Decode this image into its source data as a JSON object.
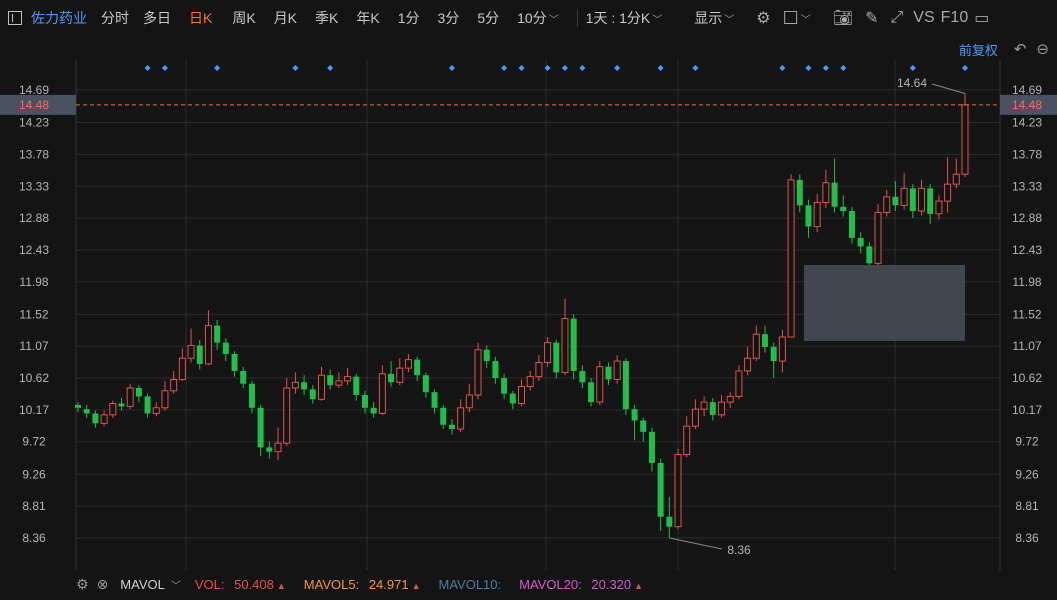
{
  "stock": {
    "name": "佐力药业"
  },
  "periods": [
    "分时",
    "多日",
    "日K",
    "周K",
    "月K",
    "季K",
    "年K",
    "1分",
    "3分",
    "5分",
    "10分"
  ],
  "active_period": "日K",
  "range_select": "1天 : 1分K",
  "display_label": "显示",
  "vs_label": "VS",
  "f10_label": "F10",
  "fuquan_label": "前复权",
  "price_axis": {
    "ticks": [
      "14.69",
      "14.23",
      "13.78",
      "13.33",
      "12.88",
      "12.43",
      "11.98",
      "11.52",
      "11.07",
      "10.62",
      "10.17",
      "9.72",
      "9.26",
      "8.81",
      "8.36"
    ],
    "current_price": "14.48",
    "high_label": "14.64",
    "low_label": "8.36"
  },
  "indicators": {
    "name": "MAVOL",
    "vol_label": "VOL:",
    "vol_value": "50.408",
    "mavol5_label": "MAVOL5:",
    "mavol5_value": "24.971",
    "mavol10_label": "MAVOL10:",
    "mavol20_label": "MAVOL20:",
    "mavol20_value": "20.320"
  },
  "colors": {
    "up": "#e3524a",
    "down": "#1fbf4a",
    "accent_orange": "#ff7a1a",
    "accent_blue": "#4a9cff",
    "mavol5": "#f59a36",
    "mavol10": "#4d7fa8",
    "mavol20": "#d45ad6"
  },
  "chart_data": {
    "type": "candlestick",
    "ylim": [
      8.36,
      14.69
    ],
    "candles": [
      [
        10.24,
        10.2,
        10.28,
        10.14
      ],
      [
        10.18,
        10.12,
        10.24,
        10.06
      ],
      [
        10.12,
        9.98,
        10.16,
        9.92
      ],
      [
        9.98,
        10.1,
        10.16,
        9.94
      ],
      [
        10.1,
        10.26,
        10.3,
        10.06
      ],
      [
        10.26,
        10.22,
        10.34,
        10.16
      ],
      [
        10.22,
        10.48,
        10.54,
        10.18
      ],
      [
        10.48,
        10.36,
        10.52,
        10.28
      ],
      [
        10.36,
        10.12,
        10.4,
        10.06
      ],
      [
        10.12,
        10.2,
        10.28,
        10.08
      ],
      [
        10.2,
        10.44,
        10.58,
        10.16
      ],
      [
        10.44,
        10.6,
        10.72,
        10.4
      ],
      [
        10.6,
        10.9,
        11.04,
        10.58
      ],
      [
        10.9,
        11.08,
        11.32,
        10.84
      ],
      [
        11.08,
        10.82,
        11.16,
        10.74
      ],
      [
        10.82,
        11.36,
        11.58,
        10.8
      ],
      [
        11.36,
        11.12,
        11.44,
        11.02
      ],
      [
        11.12,
        10.96,
        11.18,
        10.86
      ],
      [
        10.96,
        10.72,
        11.0,
        10.64
      ],
      [
        10.72,
        10.54,
        10.78,
        10.48
      ],
      [
        10.54,
        10.2,
        10.58,
        10.12
      ],
      [
        10.2,
        9.64,
        10.24,
        9.52
      ],
      [
        9.64,
        9.58,
        9.72,
        9.48
      ],
      [
        9.58,
        9.7,
        9.92,
        9.46
      ],
      [
        9.7,
        10.48,
        10.62,
        9.66
      ],
      [
        10.48,
        10.56,
        10.7,
        10.4
      ],
      [
        10.56,
        10.46,
        10.66,
        10.38
      ],
      [
        10.46,
        10.32,
        10.52,
        10.26
      ],
      [
        10.32,
        10.66,
        10.78,
        10.3
      ],
      [
        10.66,
        10.52,
        10.74,
        10.46
      ],
      [
        10.52,
        10.58,
        10.7,
        10.48
      ],
      [
        10.58,
        10.64,
        10.76,
        10.52
      ],
      [
        10.64,
        10.38,
        10.68,
        10.3
      ],
      [
        10.38,
        10.2,
        10.44,
        10.12
      ],
      [
        10.2,
        10.12,
        10.28,
        10.06
      ],
      [
        10.12,
        10.68,
        10.8,
        10.1
      ],
      [
        10.68,
        10.56,
        10.86,
        10.5
      ],
      [
        10.56,
        10.76,
        10.9,
        10.52
      ],
      [
        10.76,
        10.88,
        10.96,
        10.7
      ],
      [
        10.88,
        10.66,
        10.92,
        10.58
      ],
      [
        10.66,
        10.42,
        10.7,
        10.34
      ],
      [
        10.42,
        10.2,
        10.46,
        10.12
      ],
      [
        10.2,
        9.96,
        10.24,
        9.9
      ],
      [
        9.96,
        9.9,
        10.04,
        9.82
      ],
      [
        9.9,
        10.2,
        10.32,
        9.86
      ],
      [
        10.2,
        10.38,
        10.54,
        10.14
      ],
      [
        10.38,
        11.02,
        11.12,
        10.32
      ],
      [
        11.02,
        10.86,
        11.08,
        10.76
      ],
      [
        10.86,
        10.62,
        10.92,
        10.54
      ],
      [
        10.62,
        10.4,
        10.68,
        10.32
      ],
      [
        10.4,
        10.26,
        10.44,
        10.18
      ],
      [
        10.26,
        10.5,
        10.6,
        10.22
      ],
      [
        10.5,
        10.64,
        10.72,
        10.44
      ],
      [
        10.64,
        10.84,
        10.94,
        10.58
      ],
      [
        10.84,
        11.12,
        11.2,
        10.78
      ],
      [
        11.12,
        10.7,
        11.16,
        10.62
      ],
      [
        10.7,
        11.46,
        11.74,
        10.66
      ],
      [
        11.46,
        10.72,
        11.52,
        10.6
      ],
      [
        10.72,
        10.56,
        10.8,
        10.48
      ],
      [
        10.56,
        10.28,
        10.62,
        10.22
      ],
      [
        10.28,
        10.78,
        10.86,
        10.24
      ],
      [
        10.78,
        10.6,
        10.84,
        10.52
      ],
      [
        10.6,
        10.86,
        10.94,
        10.54
      ],
      [
        10.86,
        10.18,
        10.9,
        10.1
      ],
      [
        10.18,
        10.02,
        10.24,
        9.74
      ],
      [
        10.02,
        9.86,
        10.06,
        9.72
      ],
      [
        9.86,
        9.42,
        9.92,
        9.3
      ],
      [
        9.42,
        8.66,
        9.48,
        8.46
      ],
      [
        8.66,
        8.52,
        8.94,
        8.36
      ],
      [
        8.52,
        9.54,
        9.62,
        8.48
      ],
      [
        9.54,
        9.94,
        10.08,
        9.5
      ],
      [
        9.94,
        10.18,
        10.32,
        9.9
      ],
      [
        10.18,
        10.28,
        10.36,
        10.08
      ],
      [
        10.28,
        10.1,
        10.34,
        10.02
      ],
      [
        10.1,
        10.28,
        10.38,
        10.06
      ],
      [
        10.28,
        10.36,
        10.42,
        10.2
      ],
      [
        10.36,
        10.72,
        10.8,
        10.32
      ],
      [
        10.72,
        10.9,
        11.06,
        10.66
      ],
      [
        10.9,
        11.24,
        11.36,
        10.86
      ],
      [
        11.24,
        11.06,
        11.36,
        10.98
      ],
      [
        11.06,
        10.86,
        11.12,
        10.62
      ],
      [
        10.86,
        11.2,
        11.3,
        10.7
      ],
      [
        11.2,
        13.42,
        13.5,
        11.92
      ],
      [
        13.42,
        13.06,
        13.5,
        12.96
      ],
      [
        13.06,
        12.76,
        13.14,
        12.6
      ],
      [
        12.76,
        13.1,
        13.22,
        12.68
      ],
      [
        13.1,
        13.38,
        13.56,
        13.02
      ],
      [
        13.38,
        13.04,
        13.72,
        12.96
      ],
      [
        13.04,
        12.98,
        13.2,
        12.9
      ],
      [
        12.98,
        12.6,
        13.04,
        12.52
      ],
      [
        12.6,
        12.48,
        12.68,
        12.38
      ],
      [
        12.48,
        12.24,
        12.54,
        12.2
      ],
      [
        12.24,
        12.96,
        13.08,
        12.2
      ],
      [
        12.96,
        13.18,
        13.28,
        12.9
      ],
      [
        13.18,
        13.06,
        13.4,
        12.98
      ],
      [
        13.06,
        13.3,
        13.52,
        13.0
      ],
      [
        13.3,
        12.98,
        13.36,
        12.88
      ],
      [
        12.98,
        13.3,
        13.42,
        12.92
      ],
      [
        13.3,
        12.94,
        13.36,
        12.8
      ],
      [
        12.94,
        13.12,
        13.2,
        12.86
      ],
      [
        13.12,
        13.36,
        13.74,
        12.96
      ],
      [
        13.36,
        13.5,
        13.72,
        13.3
      ],
      [
        13.5,
        14.48,
        14.64,
        13.46
      ]
    ],
    "signal_marker_indices": [
      8,
      10,
      16,
      25,
      29,
      43,
      49,
      51,
      54,
      56,
      58,
      62,
      67,
      71,
      81,
      84,
      86,
      88,
      96,
      102
    ]
  }
}
